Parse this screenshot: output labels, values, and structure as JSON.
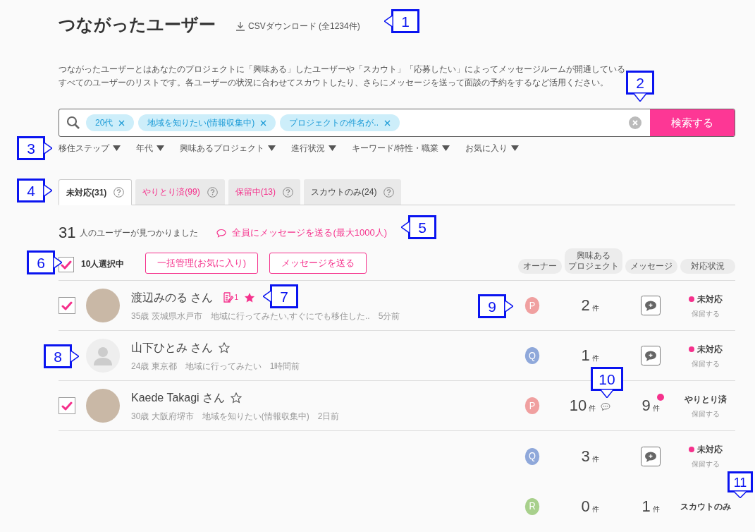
{
  "title": "つながったユーザー",
  "csv_link": "CSVダウンロード (全1234件)",
  "description": [
    "つながったユーザーとはあなたのプロジェクトに「興味ある」したユーザーや「スカウト」「応募したい」によってメッセージルームが開通している",
    "すべてのユーザーのリストです。各ユーザーの状況に合わせてスカウトしたり、さらにメッセージを送って面談の予約をするなど活用ください。"
  ],
  "search": {
    "chips": [
      "20代",
      "地域を知りたい(情報収集中)",
      "プロジェクトの件名が.."
    ],
    "button": "検索する"
  },
  "filters": [
    "移住ステップ",
    "年代",
    "興味あるプロジェクト",
    "進行状況",
    "キーワード/特性・職業",
    "お気に入り"
  ],
  "tabs": [
    {
      "label": "未対応(31)",
      "selected": true,
      "color": "#333333"
    },
    {
      "label": "やりとり済(99)",
      "selected": false,
      "color": "#f5318c"
    },
    {
      "label": "保留中(13)",
      "selected": false,
      "color": "#f5318c"
    },
    {
      "label": "スカウトのみ(24)",
      "selected": false,
      "color": "#444444"
    }
  ],
  "result_count": "31",
  "result_text": "人のユーザーが見つかりました",
  "message_all": "全員にメッセージを送る(最大1000人)",
  "bulk": {
    "checked": true,
    "selected_text": "10人選択中",
    "buttons": [
      "一括管理(お気に入り)",
      "メッセージを送る"
    ]
  },
  "columns": [
    [
      "オーナー"
    ],
    [
      "興味ある",
      "プロジェクト"
    ],
    [
      "メッセージ"
    ],
    [
      "対応状況"
    ]
  ],
  "rows": [
    {
      "checked": true,
      "has_photo": true,
      "name": "渡辺みのる さん",
      "memo_count": "1",
      "favorite": true,
      "meta": [
        "35歳 茨城県水戸市",
        "地域に行ってみたい,すぐにでも移住した..",
        "5分前"
      ],
      "owner": {
        "letter": "P",
        "color": "#f0a0a0"
      },
      "projects": {
        "value": "2",
        "unit": "件",
        "comment": false
      },
      "message": {
        "kind": "button"
      },
      "status": {
        "label": "未対応",
        "dot": true,
        "hold": "保留する"
      }
    },
    {
      "has_photo": false,
      "name": "山下ひとみ さん",
      "favorite": false,
      "meta": [
        "24歳 東京都",
        "地域に行ってみたい",
        "1時間前"
      ],
      "owner": {
        "letter": "Q",
        "color": "#8fa8da"
      },
      "projects": {
        "value": "1",
        "unit": "件",
        "comment": false
      },
      "message": {
        "kind": "button"
      },
      "status": {
        "label": "未対応",
        "dot": true,
        "hold": "保留する"
      }
    },
    {
      "checked": true,
      "has_photo": true,
      "name": "Kaede Takagi さん",
      "favorite": false,
      "meta": [
        "30歳 大阪府堺市",
        "地域を知りたい(情報収集中)",
        "2日前"
      ],
      "owner": {
        "letter": "P",
        "color": "#f0a0a0"
      },
      "projects": {
        "value": "10",
        "unit": "件",
        "comment": true
      },
      "message": {
        "kind": "count",
        "value": "9",
        "unit": "件",
        "unread": true
      },
      "status": {
        "label": "やりとり済",
        "dot": false,
        "hold": "保留する"
      }
    },
    {
      "owner": {
        "letter": "Q",
        "color": "#8fa8da"
      },
      "projects": {
        "value": "3",
        "unit": "件",
        "comment": false
      },
      "message": {
        "kind": "button"
      },
      "status": {
        "label": "未対応",
        "dot": true,
        "hold": "保留する"
      }
    },
    {
      "owner": {
        "letter": "R",
        "color": "#a8d08c"
      },
      "projects": {
        "value": "0",
        "unit": "件",
        "comment": false
      },
      "message": {
        "kind": "count",
        "value": "1",
        "unit": "件",
        "unread": false
      },
      "status": {
        "label": "スカウトのみ",
        "dot": false
      }
    }
  ],
  "callouts": [
    "1",
    "2",
    "3",
    "4",
    "5",
    "6",
    "7",
    "8",
    "9",
    "10",
    "11"
  ]
}
